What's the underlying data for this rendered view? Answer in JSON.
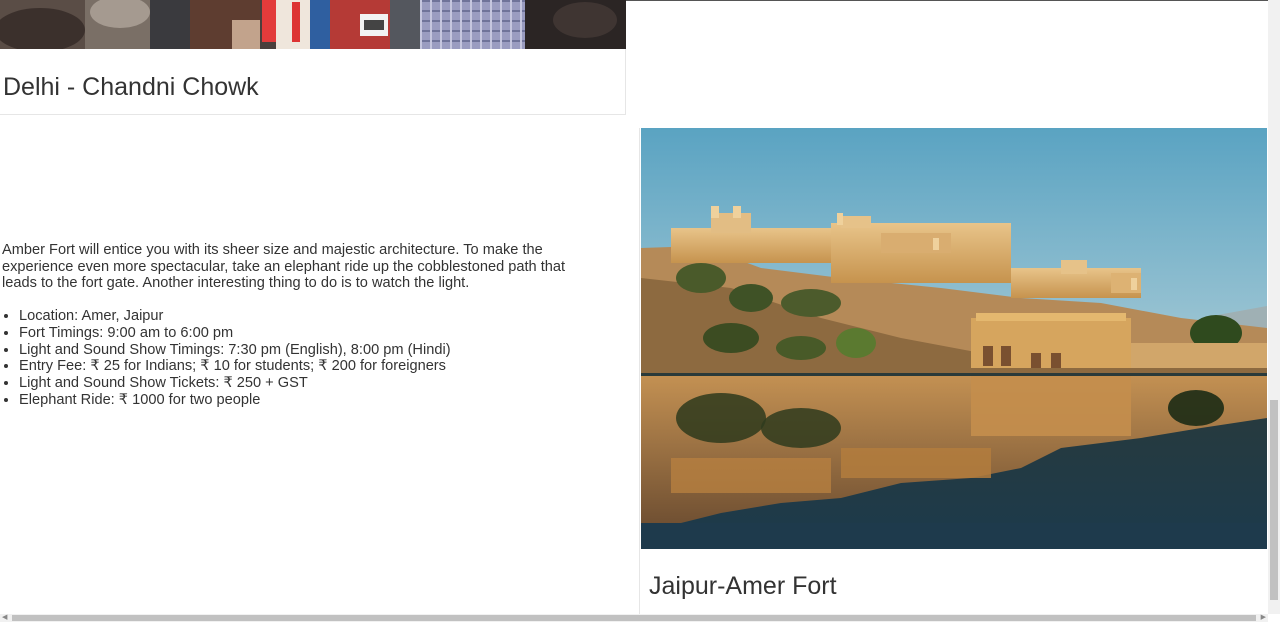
{
  "cards": [
    {
      "title": "Delhi - Chandni Chowk",
      "image": "photo-chandni-chowk-crowd"
    },
    {
      "title": "Jaipur-Amer Fort",
      "image": "photo-amer-fort-lake-reflection"
    }
  ],
  "description": {
    "paragraph": "Amber Fort will entice you with its sheer size and majestic architecture. To make the experience even more spectacular, take an elephant ride up the cobblestoned path that leads to the fort gate. Another interesting thing to do is to watch the light.",
    "details": [
      "Location: Amer, Jaipur",
      "Fort Timings: 9:00 am to 6:00 pm",
      "Light and Sound Show Timings: 7:30 pm (English), 8:00 pm (Hindi)",
      "Entry Fee: ₹ 25 for Indians; ₹ 10 for students; ₹ 200 for foreigners",
      "Light and Sound Show Tickets: ₹ 250 + GST",
      "Elephant Ride: ₹ 1000 for two people"
    ]
  },
  "colors": {
    "text": "#333333",
    "border": "#e6e6e6",
    "scrollbar_track": "#f1f1f1",
    "scrollbar_thumb": "#c1c1c1"
  }
}
